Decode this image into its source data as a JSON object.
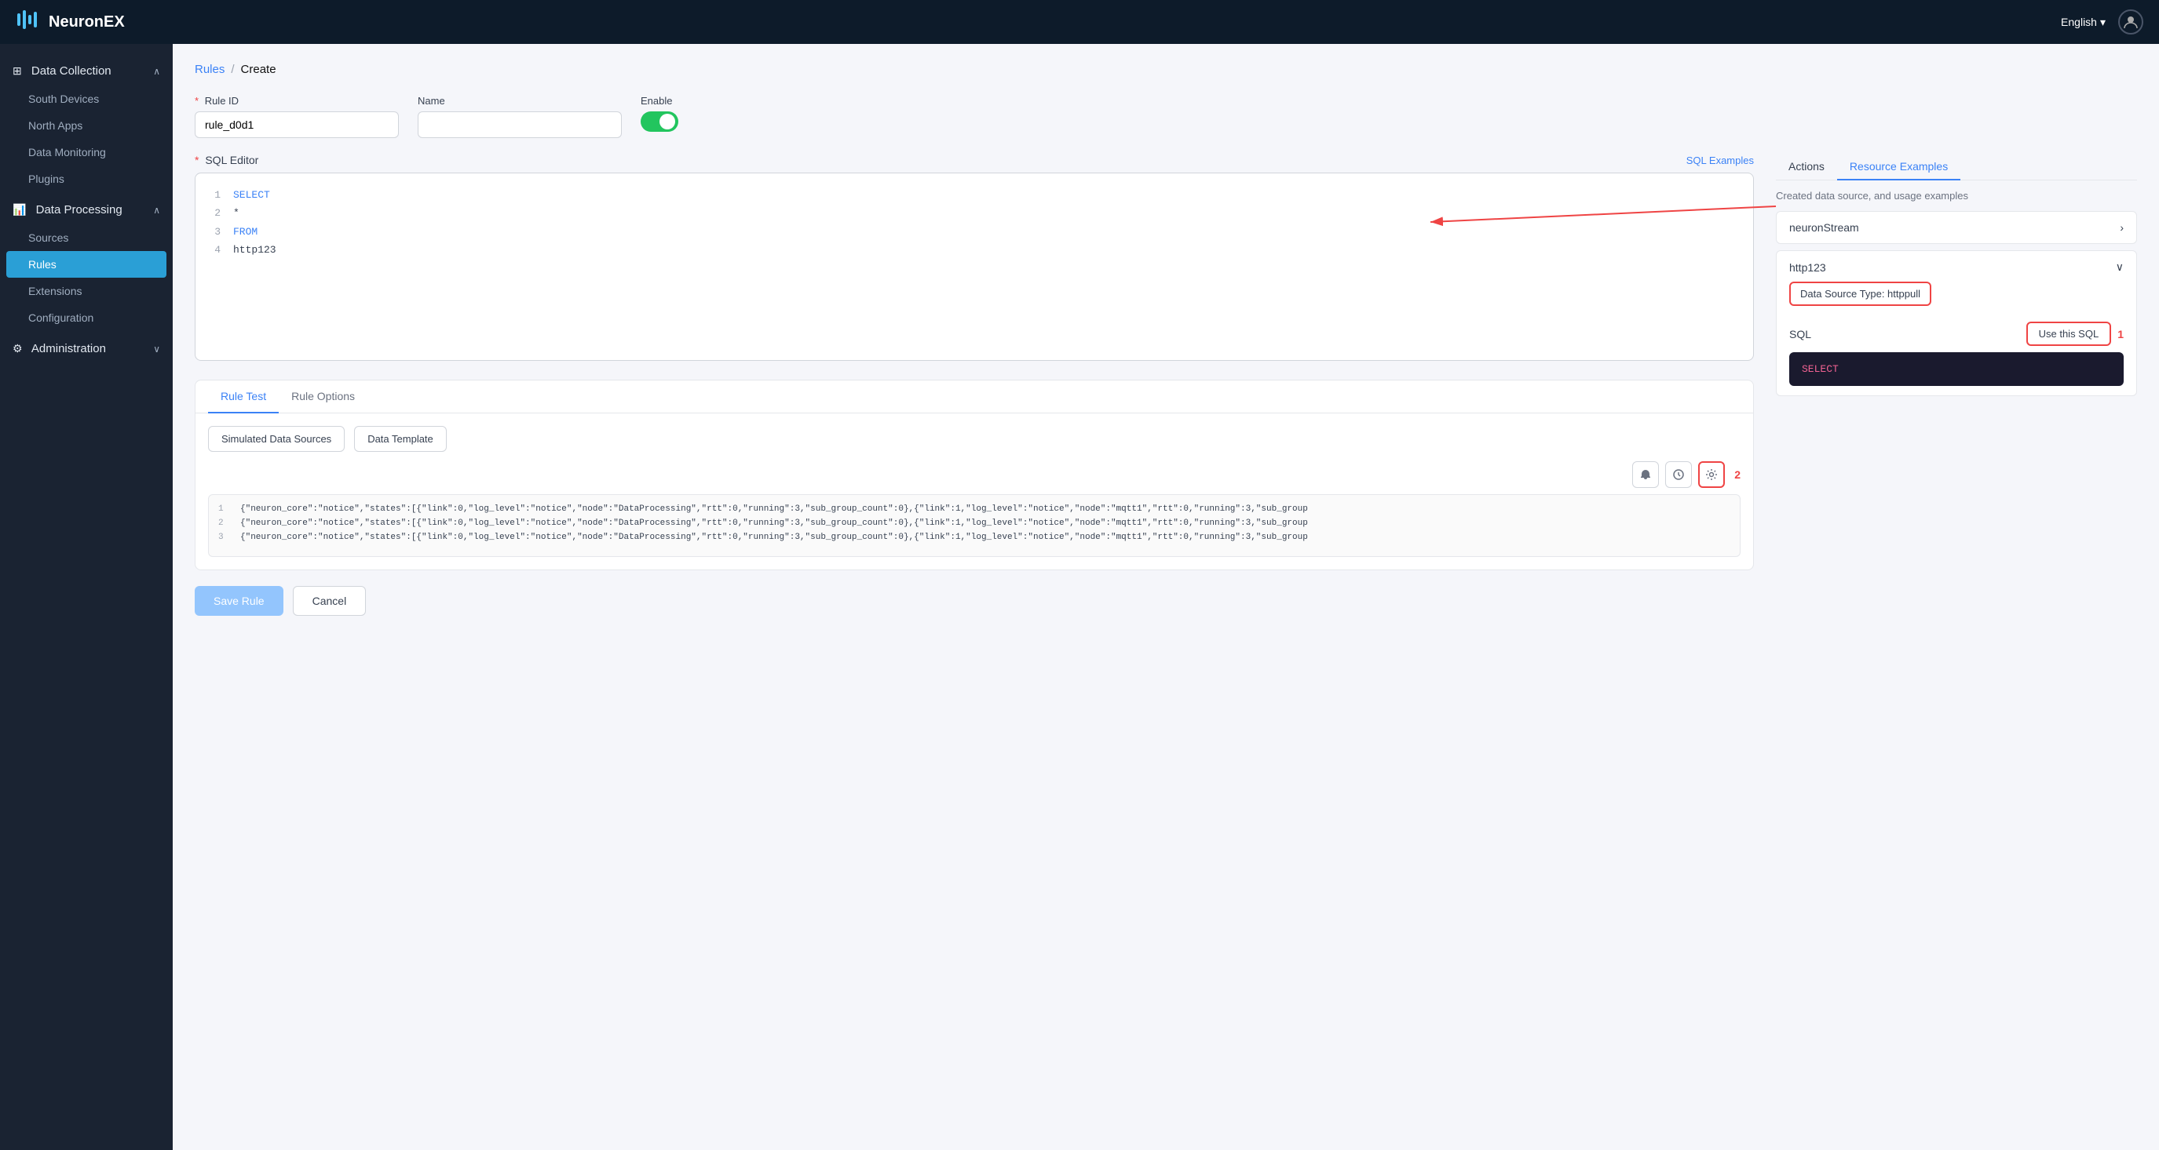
{
  "header": {
    "logo_text": "NeuronEX",
    "lang_label": "English",
    "lang_chevron": "▾"
  },
  "sidebar": {
    "data_collection": {
      "label": "Data Collection",
      "icon": "⊞",
      "chevron": "∧",
      "items": [
        {
          "id": "south-devices",
          "label": "South Devices"
        },
        {
          "id": "north-apps",
          "label": "North Apps"
        },
        {
          "id": "data-monitoring",
          "label": "Data Monitoring"
        },
        {
          "id": "plugins",
          "label": "Plugins"
        }
      ]
    },
    "data_processing": {
      "label": "Data Processing",
      "icon": "⚡",
      "chevron": "∧",
      "items": [
        {
          "id": "sources",
          "label": "Sources"
        },
        {
          "id": "rules",
          "label": "Rules",
          "active": true
        },
        {
          "id": "extensions",
          "label": "Extensions"
        },
        {
          "id": "configuration",
          "label": "Configuration"
        }
      ]
    },
    "administration": {
      "label": "Administration",
      "icon": "⚙",
      "chevron": "∨"
    }
  },
  "breadcrumb": {
    "link": "Rules",
    "separator": "/",
    "current": "Create"
  },
  "form": {
    "rule_id_label": "Rule ID",
    "rule_id_value": "rule_d0d1",
    "name_label": "Name",
    "name_placeholder": "",
    "enable_label": "Enable",
    "required_marker": "*"
  },
  "sql_editor": {
    "label": "SQL Editor",
    "examples_link": "SQL Examples",
    "lines": [
      {
        "num": "1",
        "content": "SELECT",
        "type": "keyword"
      },
      {
        "num": "2",
        "content": "  *",
        "type": "text"
      },
      {
        "num": "3",
        "content": "FROM",
        "type": "keyword"
      },
      {
        "num": "4",
        "content": "  http123",
        "type": "text"
      }
    ]
  },
  "right_panel": {
    "tab_actions": "Actions",
    "tab_resource": "Resource Examples",
    "description": "Created data source, and usage examples",
    "neuron_stream_label": "neuronStream",
    "http123_label": "http123",
    "data_source_type_label": "Data Source Type: httppull",
    "sql_label": "SQL",
    "use_sql_btn": "Use this SQL",
    "annotation_1": "1",
    "annotation_2": "2",
    "sql_preview": "SELECT"
  },
  "rule_test": {
    "tab_test": "Rule Test",
    "tab_options": "Rule Options",
    "btn_sim_data": "Simulated Data Sources",
    "btn_data_template": "Data Template",
    "tool_icon_1": "🔔",
    "tool_icon_2": "⏱",
    "tool_icon_3": "⚙"
  },
  "output_lines": [
    {
      "num": "1",
      "text": "{\"neuron_core\":\"notice\",\"states\":[{\"link\":0,\"log_level\":\"notice\",\"node\":\"DataProcessing\",\"rtt\":0,\"running\":3,\"sub_group_count\":0},{\"link\":1,\"log_level\":\"notice\",\"node\":\"mqtt1\",\"rtt\":0,\"running\":3,\"sub_group"
    },
    {
      "num": "2",
      "text": "{\"neuron_core\":\"notice\",\"states\":[{\"link\":0,\"log_level\":\"notice\",\"node\":\"DataProcessing\",\"rtt\":0,\"running\":3,\"sub_group_count\":0},{\"link\":1,\"log_level\":\"notice\",\"node\":\"mqtt1\",\"rtt\":0,\"running\":3,\"sub_group"
    },
    {
      "num": "3",
      "text": "{\"neuron_core\":\"notice\",\"states\":[{\"link\":0,\"log_level\":\"notice\",\"node\":\"DataProcessing\",\"rtt\":0,\"running\":3,\"sub_group_count\":0},{\"link\":1,\"log_level\":\"notice\",\"node\":\"mqtt1\",\"rtt\":0,\"running\":3,\"sub_group"
    }
  ],
  "actions": {
    "save_btn": "Save Rule",
    "cancel_btn": "Cancel"
  }
}
